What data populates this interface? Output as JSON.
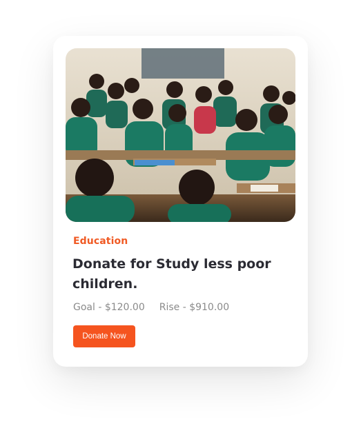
{
  "card": {
    "category": "Education",
    "title": "Donate for Study less poor children.",
    "goal": "Goal - $120.00",
    "rise": "Rise - $910.00",
    "button_label": "Donate Now"
  },
  "colors": {
    "accent": "#f5541f",
    "category": "#f05a24",
    "title": "#2b2b33",
    "muted": "#8a8a8a"
  }
}
